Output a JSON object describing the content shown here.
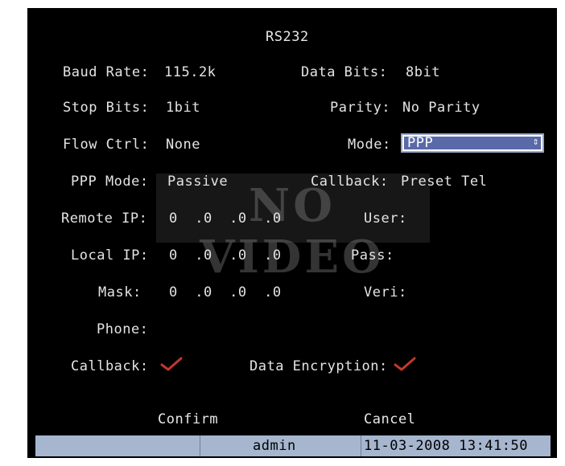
{
  "title": "RS232",
  "fields": {
    "baud_rate_label": "Baud Rate:",
    "baud_rate_value": "115.2k",
    "data_bits_label": "Data Bits:",
    "data_bits_value": "8bit",
    "stop_bits_label": "Stop Bits:",
    "stop_bits_value": "1bit",
    "parity_label": "Parity:",
    "parity_value": "No Parity",
    "flow_ctrl_label": "Flow Ctrl:",
    "flow_ctrl_value": "None",
    "mode_label": "Mode:",
    "mode_value": "PPP",
    "ppp_mode_label": "PPP Mode:",
    "ppp_mode_value": "Passive",
    "callback_mode_label": "Callback:",
    "callback_mode_value": "Preset Tel",
    "remote_ip_label": "Remote IP:",
    "remote_ip_value": "0  .0  .0  .0",
    "user_label": "User:",
    "local_ip_label": "Local IP:",
    "local_ip_value": "0  .0  .0  .0",
    "pass_label": "Pass:",
    "mask_label": "Mask:",
    "mask_value": "0  .0  .0  .0",
    "veri_label": "Veri:",
    "phone_label": "Phone:",
    "callback_label": "Callback:",
    "callback_checked": true,
    "data_encryption_label": "Data Encryption:",
    "data_encryption_checked": true
  },
  "overlay_text": "NO VIDEO",
  "buttons": {
    "confirm": "Confirm",
    "cancel": "Cancel"
  },
  "statusbar": {
    "user": "admin",
    "datetime": "11-03-2008 13:41:50"
  },
  "icons": {
    "select_arrow": "up-down-arrow-icon",
    "check": "checkmark-icon"
  },
  "colors": {
    "background": "#000000",
    "text": "#e4e4e4",
    "selected": "#5a6aa8",
    "check": "#c0392b",
    "statusbar": "#a5b6ce"
  }
}
